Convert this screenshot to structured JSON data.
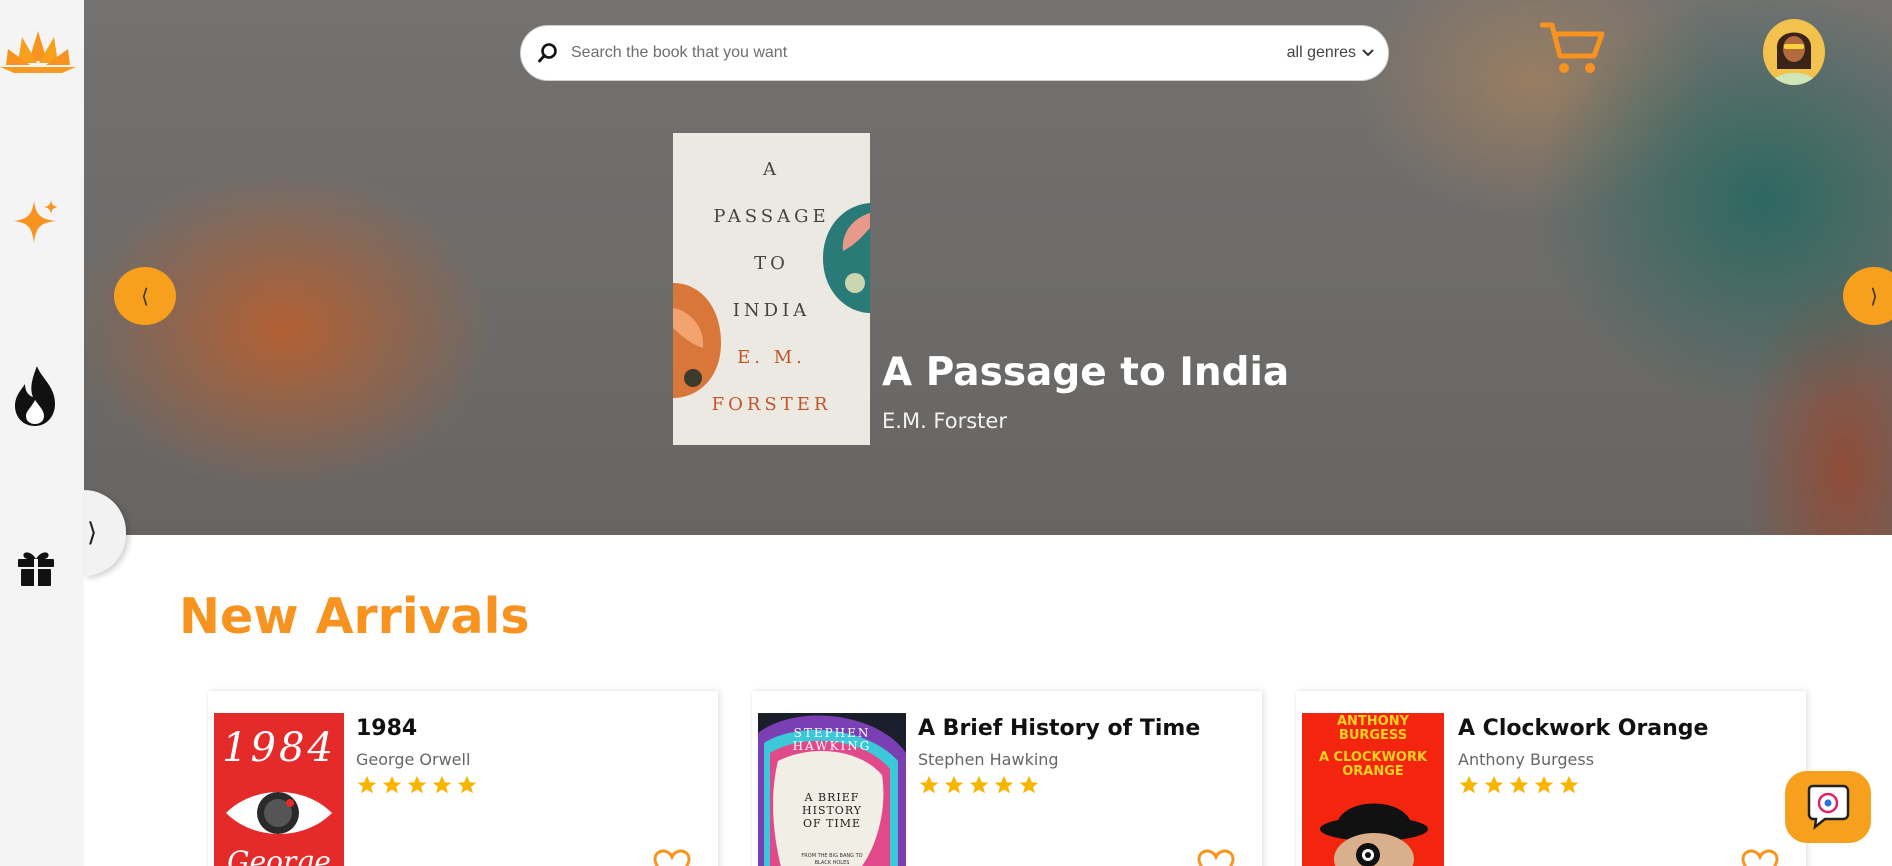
{
  "sidebar": {
    "items": [
      {
        "name": "logo",
        "icon": "lotus-logo-icon"
      },
      {
        "name": "new",
        "icon": "sparkle-icon"
      },
      {
        "name": "trending",
        "icon": "flame-icon"
      },
      {
        "name": "gifts",
        "icon": "gift-icon"
      }
    ],
    "toggle_label": "⟩"
  },
  "header": {
    "search": {
      "placeholder": "Search the book that you want",
      "value": ""
    },
    "genre_label": "all genres"
  },
  "hero": {
    "prev_label": "⟨",
    "next_label": "⟩",
    "featured": {
      "title": "A Passage to India",
      "author": "E.M. Forster",
      "cover_lines": [
        "A",
        "PASSAGE",
        "TO",
        "INDIA"
      ],
      "cover_author_lines": [
        "E. M.",
        "FORSTER"
      ]
    }
  },
  "new_arrivals": {
    "heading": "New Arrivals",
    "books": [
      {
        "title": "1984",
        "author": "George Orwell",
        "rating": 5,
        "cover_text": "1984",
        "cover_sub": "George"
      },
      {
        "title": "A Brief History of Time",
        "author": "Stephen Hawking",
        "rating": 5,
        "cover_text": "STEPHEN HAWKING",
        "cover_sub": "A BRIEF HISTORY OF TIME",
        "cover_small": "FROM THE BIG BANG TO BLACK HOLES"
      },
      {
        "title": "A Clockwork Orange",
        "author": "Anthony Burgess",
        "rating": 5,
        "cover_text": "ANTHONY BURGESS",
        "cover_sub": "A CLOCKWORK ORANGE"
      }
    ]
  },
  "colors": {
    "accent": "#f7931e",
    "star": "#f7b500",
    "chat": "#f7a01e"
  }
}
